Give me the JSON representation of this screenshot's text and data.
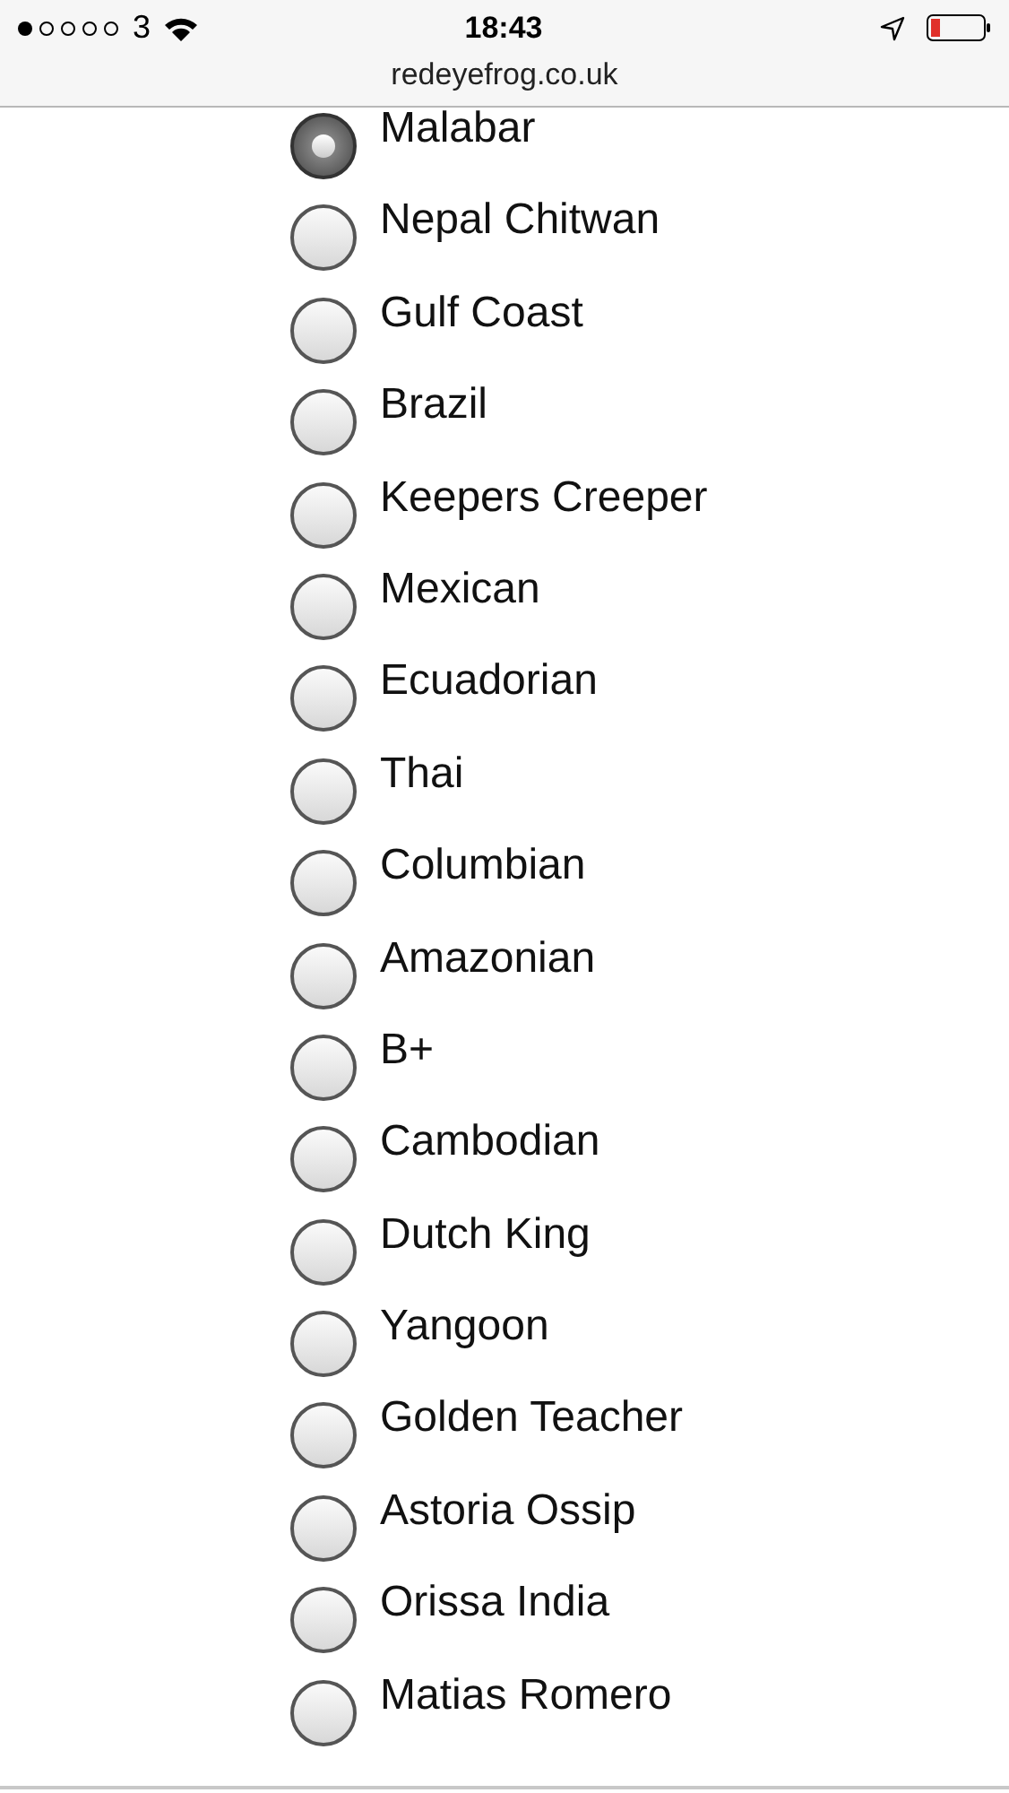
{
  "status_bar": {
    "carrier": "3",
    "time": "18:43"
  },
  "address_bar": {
    "url": "redeyefrog.co.uk"
  },
  "options": [
    {
      "label": "Malabar",
      "selected": true
    },
    {
      "label": "Nepal Chitwan",
      "selected": false
    },
    {
      "label": "Gulf Coast",
      "selected": false
    },
    {
      "label": "Brazil",
      "selected": false
    },
    {
      "label": "Keepers Creeper",
      "selected": false
    },
    {
      "label": "Mexican",
      "selected": false
    },
    {
      "label": "Ecuadorian",
      "selected": false
    },
    {
      "label": "Thai",
      "selected": false
    },
    {
      "label": "Columbian",
      "selected": false
    },
    {
      "label": "Amazonian",
      "selected": false
    },
    {
      "label": "B+",
      "selected": false
    },
    {
      "label": "Cambodian",
      "selected": false
    },
    {
      "label": "Dutch King",
      "selected": false
    },
    {
      "label": "Yangoon",
      "selected": false
    },
    {
      "label": "Golden Teacher",
      "selected": false
    },
    {
      "label": "Astoria Ossip",
      "selected": false
    },
    {
      "label": "Orissa India",
      "selected": false
    },
    {
      "label": "Matias Romero",
      "selected": false
    }
  ]
}
